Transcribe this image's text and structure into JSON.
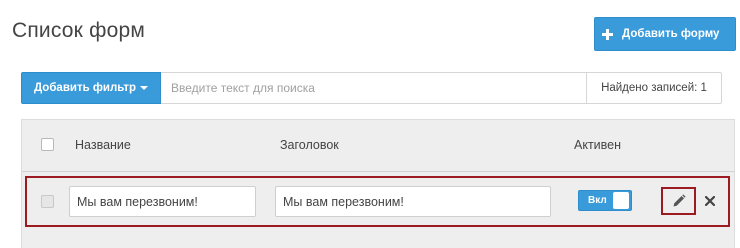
{
  "page": {
    "title": "Список форм"
  },
  "header": {
    "add_form_label": "Добавить форму"
  },
  "filter_bar": {
    "filter_button_label": "Добавить фильтр",
    "search_placeholder": "Введите текст для поиска",
    "search_value": "",
    "records_found": "Найдено записей: 1"
  },
  "table": {
    "columns": [
      "Название",
      "Заголовок",
      "Активен"
    ],
    "rows": [
      {
        "name": "Мы вам перезвоним!",
        "heading": "Мы вам перезвоним!",
        "active_label": "Вкл",
        "active": true,
        "selected": false
      }
    ]
  },
  "icons": {
    "add": "plus-icon",
    "filter_dropdown": "caret-down-icon",
    "edit": "pencil-icon",
    "delete": "close-icon"
  },
  "colors": {
    "accent": "#3a9bdb",
    "highlight": "#9b1b21",
    "table_bg": "#eeeeee"
  }
}
